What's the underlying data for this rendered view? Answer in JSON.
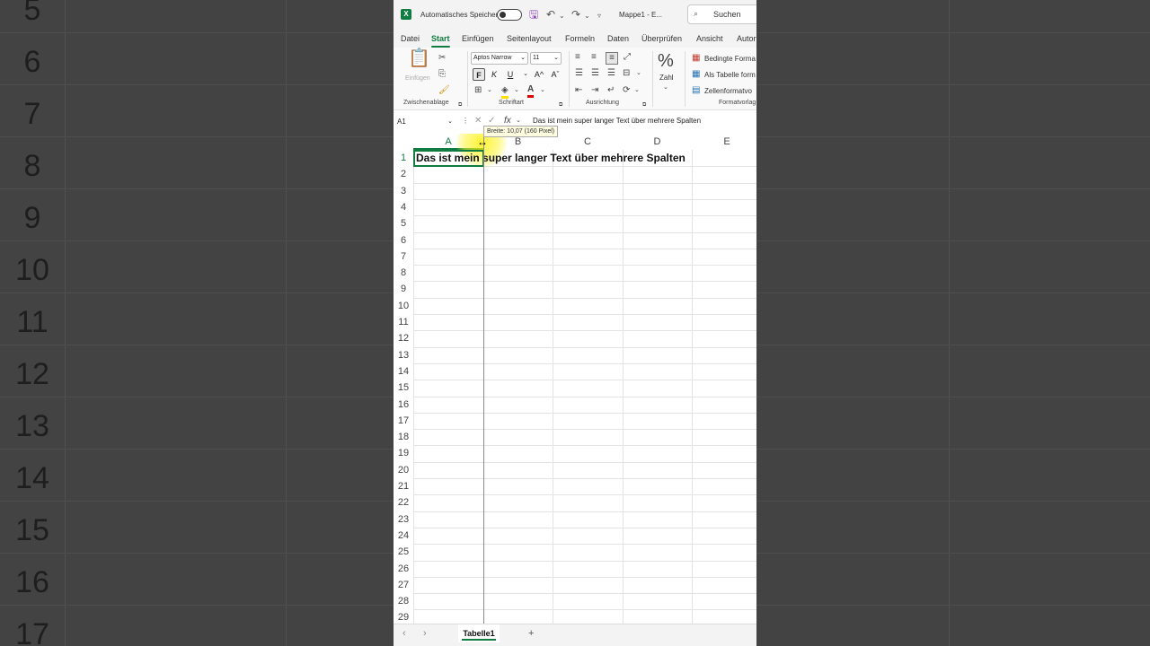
{
  "background": {
    "row_numbers": [
      "5",
      "6",
      "7",
      "8",
      "9",
      "10",
      "11",
      "12",
      "13",
      "14",
      "15",
      "16",
      "17"
    ]
  },
  "titlebar": {
    "app_icon": "X",
    "autosave_label": "Automatisches Speichern",
    "filename": "Mappe1  -  E...",
    "search_placeholder": "Suchen"
  },
  "menu_tabs": [
    "Datei",
    "Start",
    "Einfügen",
    "Seitenlayout",
    "Formeln",
    "Daten",
    "Überprüfen",
    "Ansicht",
    "Autor"
  ],
  "active_tab": "Start",
  "ribbon": {
    "clipboard": {
      "paste_label": "Einfügen",
      "group_label": "Zwischenablage"
    },
    "font": {
      "font_name": "Aptos Narrow",
      "font_size": "11",
      "bold": "F",
      "italic": "K",
      "underline": "U",
      "grow": "A^",
      "shrink": "Aˇ",
      "font_color": "A",
      "group_label": "Schriftart"
    },
    "alignment": {
      "group_label": "Ausrichtung"
    },
    "number": {
      "symbol": "%",
      "label": "Zahl"
    },
    "styles": {
      "conditional": "Bedingte Forma",
      "as_table": "Als Tabelle form",
      "cell_styles": "Zellenformatvo",
      "group_label": "Formatvorlag"
    }
  },
  "formula_bar": {
    "name_box": "A1",
    "fx": "fx",
    "content": "Das ist mein super langer Text über mehrere Spalten"
  },
  "grid": {
    "columns": [
      "A",
      "B",
      "C",
      "D",
      "E"
    ],
    "selected_column": "A",
    "rows": [
      "1",
      "2",
      "3",
      "4",
      "5",
      "6",
      "7",
      "8",
      "9",
      "10",
      "11",
      "12",
      "13",
      "14",
      "15",
      "16",
      "17",
      "18",
      "19",
      "20",
      "21",
      "22",
      "23",
      "24",
      "25",
      "26",
      "27",
      "28",
      "29"
    ],
    "cell_A1": "Das ist mein super langer Text über mehrere Spalten",
    "tooltip": "Breite: 10,07 (160 Pixel)"
  },
  "sheets": {
    "tabs": [
      "Tabelle1"
    ],
    "add": "+"
  }
}
